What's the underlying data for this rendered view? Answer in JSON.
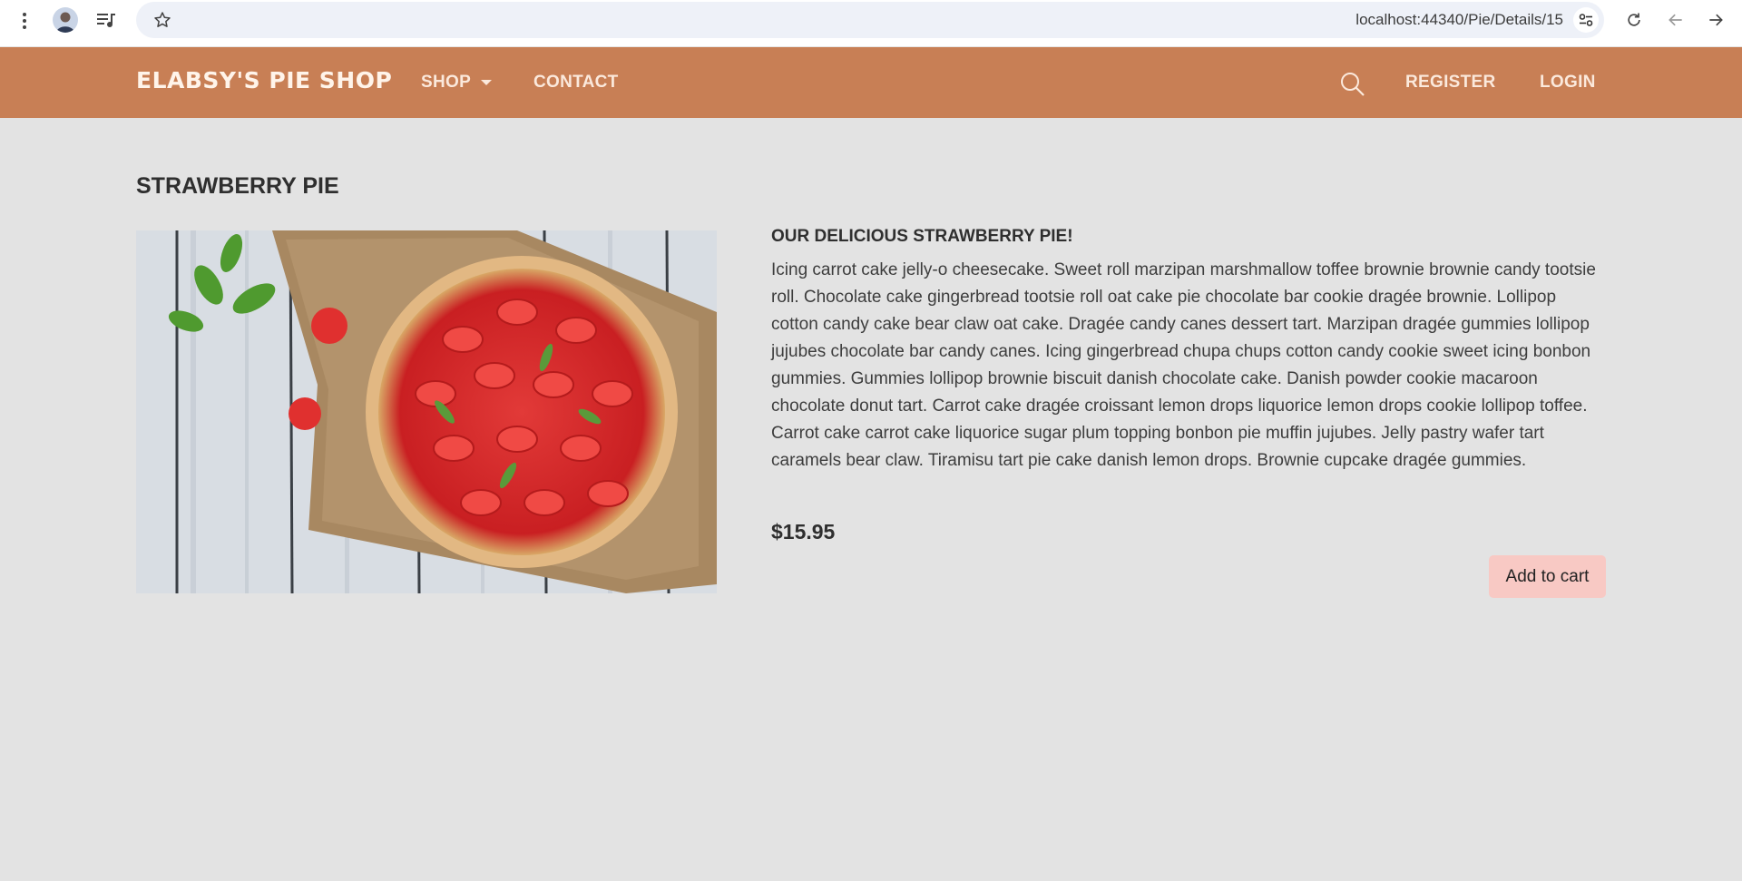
{
  "browser": {
    "url": "localhost:44340/Pie/Details/15"
  },
  "navbar": {
    "brand": "ELABSY'S PIE SHOP",
    "shop_label": "SHOP",
    "contact_label": "CONTACT",
    "register_label": "REGISTER",
    "login_label": "LOGIN",
    "color": "#c87f55"
  },
  "product": {
    "title": "STRAWBERRY PIE",
    "subtitle": "OUR DELICIOUS STRAWBERRY PIE!",
    "description": "Icing carrot cake jelly-o cheesecake. Sweet roll marzipan marshmallow toffee brownie brownie candy tootsie roll. Chocolate cake gingerbread tootsie roll oat cake pie chocolate bar cookie dragée brownie. Lollipop cotton candy cake bear claw oat cake. Dragée candy canes dessert tart. Marzipan dragée gummies lollipop jujubes chocolate bar candy canes. Icing gingerbread chupa chups cotton candy cookie sweet icing bonbon gummies. Gummies lollipop brownie biscuit danish chocolate cake. Danish powder cookie macaroon chocolate donut tart. Carrot cake dragée croissant lemon drops liquorice lemon drops cookie lollipop toffee. Carrot cake carrot cake liquorice sugar plum topping bonbon pie muffin jujubes. Jelly pastry wafer tart caramels bear claw. Tiramisu tart pie cake danish lemon drops. Brownie cupcake dragée gummies.",
    "price": "$15.95",
    "add_to_cart_label": "Add to cart"
  },
  "icons": {
    "menu": "kebab-menu-icon",
    "profile": "profile-avatar-icon",
    "media": "media-controls-icon",
    "bookmark": "star-icon",
    "site_settings": "tune-icon",
    "reload": "reload-icon",
    "back": "arrow-left-icon",
    "forward": "arrow-right-icon",
    "search": "search-icon",
    "image": "strawberry-pie-photo"
  }
}
